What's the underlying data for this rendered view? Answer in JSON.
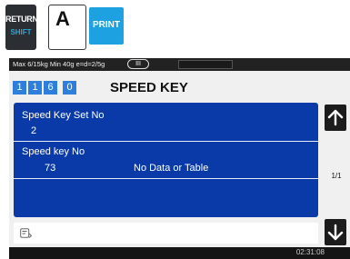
{
  "top_keys": {
    "return_label": "RETURN",
    "shift_label": "SHIFT",
    "a_label": "A",
    "print_label": "PRINT"
  },
  "status_bar": {
    "scale_spec": "Max 6/15kg Min 40g e=d=2/5g",
    "range_badge": "III"
  },
  "header": {
    "code_digits": [
      "1",
      "1",
      "6",
      "0"
    ],
    "title": "SPEED KEY"
  },
  "form": {
    "set_no_label": "Speed Key Set No",
    "set_no_value": "2",
    "key_no_label": "Speed key No",
    "key_no_value": "73",
    "key_no_message": "No Data or Table"
  },
  "side": {
    "up_icon": "arrow-up-icon",
    "down_icon": "arrow-down-icon",
    "page_indicator": "1/1"
  },
  "input": {
    "icon": "keyboard-entry-icon",
    "value": ""
  },
  "footer": {
    "clock": "02:31:08"
  },
  "colors": {
    "panel": "#0a3aa8",
    "digit_box": "#2d7fdb",
    "print_key": "#1da1e0",
    "shift_text": "#2ea7d8"
  }
}
